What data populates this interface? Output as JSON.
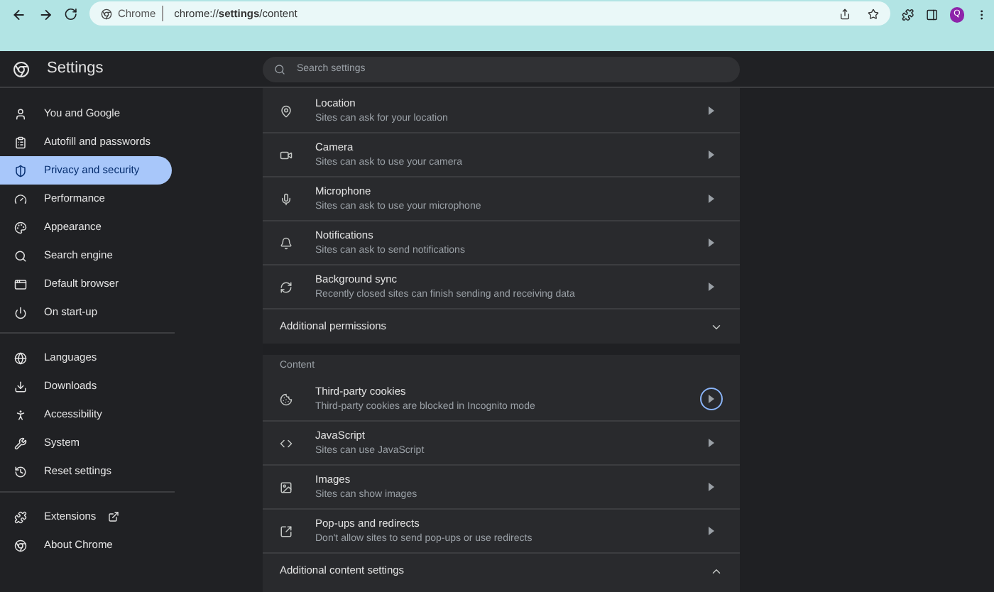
{
  "browser": {
    "site_label": "Chrome",
    "url": "chrome://**settings**/content",
    "avatar": "Q"
  },
  "header": {
    "title": "Settings",
    "search_placeholder": "Search settings"
  },
  "sidebar": {
    "groups": [
      [
        {
          "label": "You and Google",
          "kind": "person",
          "selected": false
        },
        {
          "label": "Autofill and passwords",
          "kind": "clipboard",
          "selected": false
        },
        {
          "label": "Privacy and security",
          "kind": "shield",
          "selected": true
        },
        {
          "label": "Performance",
          "kind": "gauge",
          "selected": false
        },
        {
          "label": "Appearance",
          "kind": "palette",
          "selected": false
        },
        {
          "label": "Search engine",
          "kind": "search",
          "selected": false
        },
        {
          "label": "Default browser",
          "kind": "browser",
          "selected": false
        },
        {
          "label": "On start-up",
          "kind": "power",
          "selected": false
        }
      ],
      [
        {
          "label": "Languages",
          "kind": "globe",
          "selected": false
        },
        {
          "label": "Downloads",
          "kind": "download",
          "selected": false
        },
        {
          "label": "Accessibility",
          "kind": "accessibility",
          "selected": false
        },
        {
          "label": "System",
          "kind": "wrench",
          "selected": false
        },
        {
          "label": "Reset settings",
          "kind": "history",
          "selected": false
        }
      ],
      [
        {
          "label": "Extensions",
          "kind": "puzzle",
          "selected": false,
          "external": true
        },
        {
          "label": "About Chrome",
          "kind": "chrome",
          "selected": false,
          "external": false
        }
      ]
    ]
  },
  "permissions": [
    {
      "title": "Location",
      "subtitle": "Sites can ask for your location",
      "kind": "pin",
      "focused": false
    },
    {
      "title": "Camera",
      "subtitle": "Sites can ask to use your camera",
      "kind": "camera",
      "focused": false
    },
    {
      "title": "Microphone",
      "subtitle": "Sites can ask to use your microphone",
      "kind": "mic",
      "focused": false
    },
    {
      "title": "Notifications",
      "subtitle": "Sites can ask to send notifications",
      "kind": "bell",
      "focused": false
    },
    {
      "title": "Background sync",
      "subtitle": "Recently closed sites can finish sending and receiving data",
      "kind": "sync",
      "focused": false
    }
  ],
  "additional_permissions": {
    "label": "Additional permissions",
    "expanded": false
  },
  "content_heading": "Content",
  "content": [
    {
      "title": "Third-party cookies",
      "subtitle": "Third-party cookies are blocked in Incognito mode",
      "kind": "cookie",
      "focused": true
    },
    {
      "title": "JavaScript",
      "subtitle": "Sites can use JavaScript",
      "kind": "code",
      "focused": false
    },
    {
      "title": "Images",
      "subtitle": "Sites can show images",
      "kind": "image",
      "focused": false
    },
    {
      "title": "Pop-ups and redirects",
      "subtitle": "Don't allow sites to send pop-ups or use redirects",
      "kind": "popup",
      "focused": false
    }
  ],
  "additional_content": {
    "label": "Additional content settings",
    "expanded": true
  }
}
